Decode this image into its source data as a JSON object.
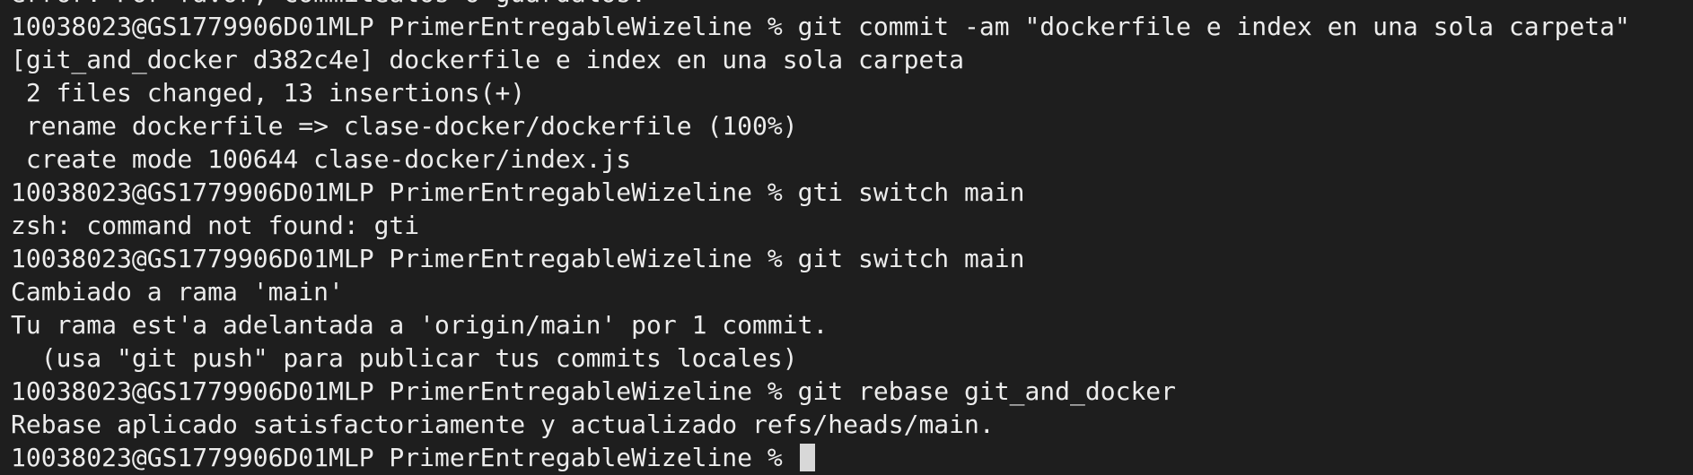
{
  "terminal": {
    "lines": [
      "error: Por favor, commitealos o guardalos.",
      "10038023@GS1779906D01MLP PrimerEntregableWizeline % git commit -am \"dockerfile e index en una sola carpeta\"",
      "[git_and_docker d382c4e] dockerfile e index en una sola carpeta",
      " 2 files changed, 13 insertions(+)",
      " rename dockerfile => clase-docker/dockerfile (100%)",
      " create mode 100644 clase-docker/index.js",
      "10038023@GS1779906D01MLP PrimerEntregableWizeline % gti switch main",
      "zsh: command not found: gti",
      "10038023@GS1779906D01MLP PrimerEntregableWizeline % git switch main",
      "Cambiado a rama 'main'",
      "Tu rama est'a adelantada a 'origin/main' por 1 commit.",
      "  (usa \"git push\" para publicar tus commits locales)",
      "10038023@GS1779906D01MLP PrimerEntregableWizeline % git rebase git_and_docker",
      "Rebase aplicado satisfactoriamente y actualizado refs/heads/main.",
      "10038023@GS1779906D01MLP PrimerEntregableWizeline % "
    ],
    "colors": {
      "background": "#1e1e1e",
      "text": "#ececec",
      "cursor": "#d8d8d8"
    }
  }
}
